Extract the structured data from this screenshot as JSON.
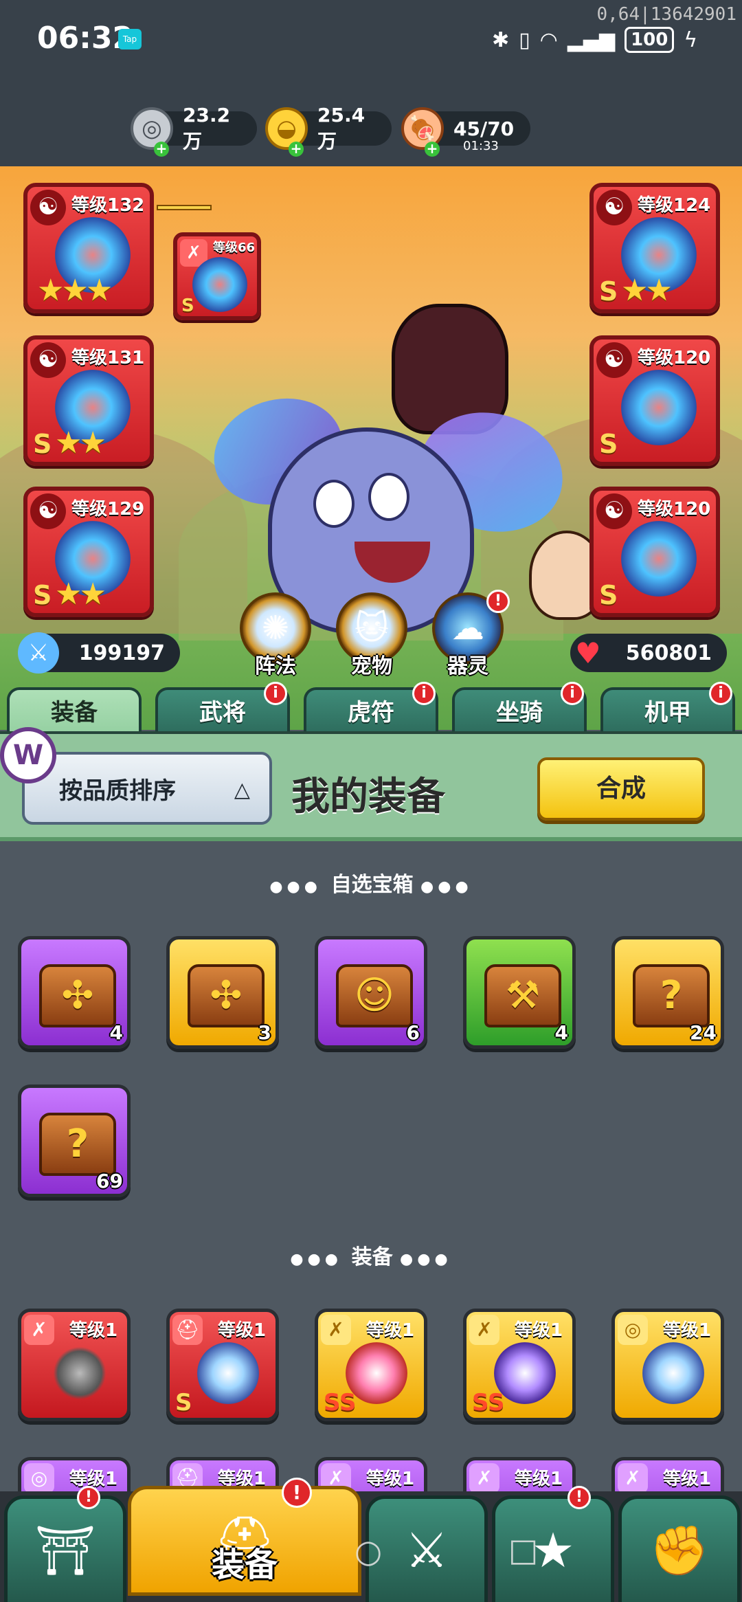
{
  "status_bar": {
    "time": "06:32",
    "tap_label": "Tap",
    "battery": "100",
    "corner_text": "0,64|13642901"
  },
  "resources": {
    "silver": {
      "value": "23.2万",
      "icon": "silver-coin-icon"
    },
    "gold": {
      "value": "25.4万",
      "icon": "gold-ingot-icon"
    },
    "stamina": {
      "value": "45/70",
      "timer": "01:33",
      "icon": "meat-icon"
    }
  },
  "equipped": {
    "left": [
      {
        "level": "等级132",
        "grade": "",
        "stars": "★★★"
      },
      {
        "level": "等级131",
        "grade": "S",
        "stars": "★★"
      },
      {
        "level": "等级129",
        "grade": "S",
        "stars": "★★"
      }
    ],
    "small_slot": {
      "level": "等级66",
      "grade": "S"
    },
    "right": [
      {
        "level": "等级124",
        "grade": "S",
        "stars": "★★"
      },
      {
        "level": "等级120",
        "grade": "S",
        "stars": ""
      },
      {
        "level": "等级120",
        "grade": "S",
        "stars": ""
      }
    ]
  },
  "stats": {
    "attack": "199197",
    "hp": "560801"
  },
  "functions": [
    {
      "label": "阵法",
      "icon": "formation-icon"
    },
    {
      "label": "宠物",
      "icon": "pet-cat-icon"
    },
    {
      "label": "器灵",
      "icon": "spirit-icon"
    }
  ],
  "tabs": [
    {
      "label": "装备",
      "active": true
    },
    {
      "label": "武将",
      "active": false
    },
    {
      "label": "虎符",
      "active": false
    },
    {
      "label": "坐骑",
      "active": false
    },
    {
      "label": "机甲",
      "active": false
    }
  ],
  "panel": {
    "sort_label": "按品质排序",
    "sort_arrow": "△",
    "title": "我的装备",
    "craft_label": "合成",
    "logo": "W"
  },
  "sections": {
    "chests_title": "自选宝箱",
    "equipment_title": "装备"
  },
  "chests": [
    {
      "color": "purple",
      "count": "4",
      "glyph": "✣"
    },
    {
      "color": "gold",
      "count": "3",
      "glyph": "✣"
    },
    {
      "color": "purple",
      "count": "6",
      "glyph": "☺"
    },
    {
      "color": "green",
      "count": "4",
      "glyph": "⚒"
    },
    {
      "color": "gold",
      "count": "24",
      "glyph": "?"
    },
    {
      "color": "purple",
      "count": "69",
      "glyph": "?"
    }
  ],
  "equipment_row1": [
    {
      "color": "red",
      "level": "等级1",
      "grade": "",
      "type": "✗"
    },
    {
      "color": "red",
      "level": "等级1",
      "grade": "S",
      "type": "⛑"
    },
    {
      "color": "gold",
      "level": "等级1",
      "grade": "SS",
      "type": "✗"
    },
    {
      "color": "gold",
      "level": "等级1",
      "grade": "SS",
      "type": "✗"
    },
    {
      "color": "gold",
      "level": "等级1",
      "grade": "",
      "type": "◎"
    }
  ],
  "equipment_row2": [
    {
      "level": "等级1"
    },
    {
      "level": "等级1"
    },
    {
      "level": "等级1"
    },
    {
      "level": "等级1"
    },
    {
      "level": "等级1"
    }
  ],
  "nav": {
    "active_label": "装备",
    "items": [
      "city-gate-icon",
      "helmet-icon",
      "sword-shield-icon",
      "gauntlet-icon",
      "fist-upgrade-icon"
    ]
  },
  "colors": {
    "accent": "#f0a900",
    "panel": "#91c59c",
    "tab": "#2c6a5b",
    "badge": "#e0262a"
  }
}
